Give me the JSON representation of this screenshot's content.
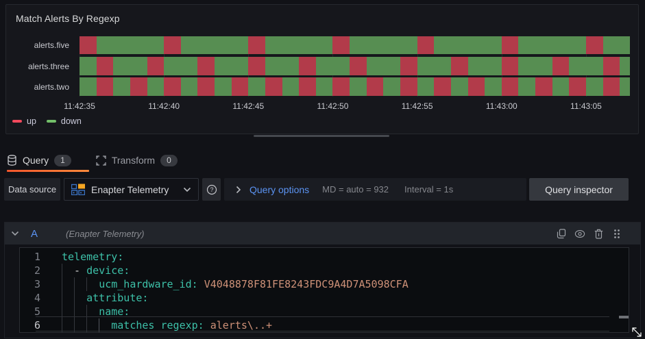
{
  "panel": {
    "title": "Match Alerts By Regexp",
    "legend": [
      {
        "label": "up",
        "color": "#f2495c"
      },
      {
        "label": "down",
        "color": "#73bf69"
      }
    ]
  },
  "chart_data": {
    "type": "state-timeline",
    "title": "Match Alerts By Regexp",
    "time_start": "11:42:35",
    "time_end": "11:43:08",
    "total_span_s": 32.6,
    "interval_s": 1,
    "x_ticks": [
      {
        "label": "11:42:35",
        "offset_s": 0
      },
      {
        "label": "11:42:40",
        "offset_s": 5
      },
      {
        "label": "11:42:45",
        "offset_s": 10
      },
      {
        "label": "11:42:50",
        "offset_s": 15
      },
      {
        "label": "11:42:55",
        "offset_s": 20
      },
      {
        "label": "11:43:00",
        "offset_s": 25
      },
      {
        "label": "11:43:05",
        "offset_s": 30
      }
    ],
    "states": {
      "u": {
        "name": "up",
        "bar_color": "#b23b4a",
        "legend_color": "#f2495c"
      },
      "d": {
        "name": "down",
        "bar_color": "#578e52",
        "legend_color": "#73bf69"
      }
    },
    "series": [
      {
        "name": "alerts.five",
        "per_second": "udddduddddudddduddddudddduddddudd",
        "note": "up 1s at every 5s boundary starting 11:42:35"
      },
      {
        "name": "alerts.three",
        "per_second": "dudduddudduddudduddudduddudduddud",
        "note": "up 1s every 3s starting 11:42:36"
      },
      {
        "name": "alerts.two",
        "per_second": "dudududududududududududududududud",
        "note": "up 1s every 2s starting 11:42:36"
      }
    ]
  },
  "tabs": [
    {
      "label": "Query",
      "count": "1",
      "active": true
    },
    {
      "label": "Transform",
      "count": "0",
      "active": false
    }
  ],
  "datasource_bar": {
    "label": "Data source",
    "selected": "Enapter Telemetry",
    "query_options_label": "Query options",
    "max_data_points": "MD = auto = 932",
    "interval": "Interval = 1s",
    "inspector_label": "Query inspector"
  },
  "query_row": {
    "ref_id": "A",
    "datasource_hint": "(Enapter Telemetry)"
  },
  "editor": {
    "language": "yaml",
    "active_line": 6,
    "lines": [
      {
        "num": "1",
        "guides": [],
        "tokens": [
          {
            "t": "key",
            "s": "telemetry:"
          }
        ]
      },
      {
        "num": "2",
        "guides": [
          0
        ],
        "tokens": [
          {
            "t": "plain",
            "s": "  - "
          },
          {
            "t": "key",
            "s": "device:"
          }
        ]
      },
      {
        "num": "3",
        "guides": [
          0,
          2,
          4
        ],
        "tokens": [
          {
            "t": "plain",
            "s": "      "
          },
          {
            "t": "key",
            "s": "ucm_hardware_id:"
          },
          {
            "t": "plain",
            "s": " "
          },
          {
            "t": "val",
            "s": "V4048878F81FE8243FDC9A4D7A5098CFA"
          }
        ]
      },
      {
        "num": "4",
        "guides": [
          0,
          2
        ],
        "tokens": [
          {
            "t": "plain",
            "s": "    "
          },
          {
            "t": "key",
            "s": "attribute:"
          }
        ]
      },
      {
        "num": "5",
        "guides": [
          0,
          2,
          4
        ],
        "tokens": [
          {
            "t": "plain",
            "s": "      "
          },
          {
            "t": "key",
            "s": "name:"
          }
        ]
      },
      {
        "num": "6",
        "guides": [
          0,
          2,
          4,
          6
        ],
        "tokens": [
          {
            "t": "plain",
            "s": "        "
          },
          {
            "t": "key",
            "s": "matches_regexp:"
          },
          {
            "t": "plain",
            "s": " "
          },
          {
            "t": "val",
            "s": "alerts\\..+"
          }
        ]
      }
    ]
  }
}
